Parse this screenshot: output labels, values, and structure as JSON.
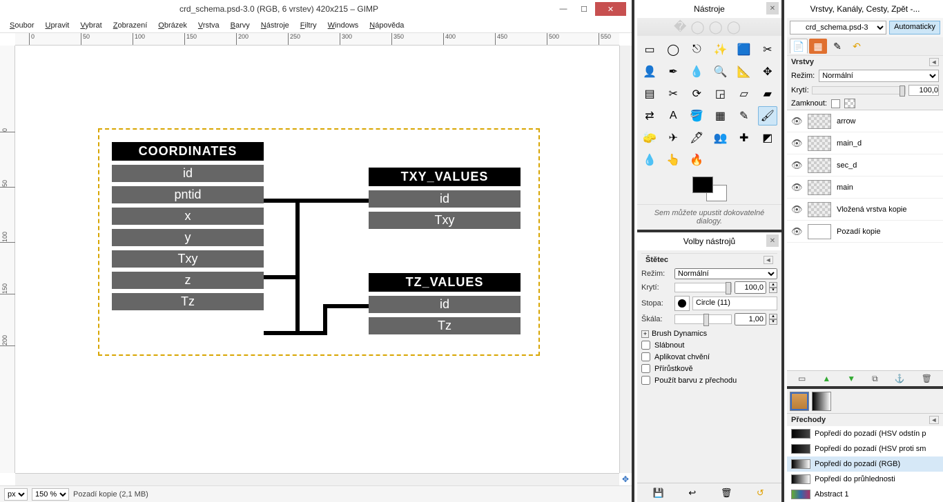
{
  "title": "crd_schema.psd-3.0 (RGB, 6 vrstev) 420x215 – GIMP",
  "menubar": [
    "Soubor",
    "Upravit",
    "Vybrat",
    "Zobrazení",
    "Obrázek",
    "Vrstva",
    "Barvy",
    "Nástroje",
    "Filtry",
    "Windows",
    "Nápověda"
  ],
  "ruler_h": [
    "0",
    "50",
    "100",
    "150",
    "200",
    "250",
    "300",
    "350",
    "400",
    "450",
    "500",
    "550"
  ],
  "ruler_v": [
    "0",
    "50",
    "100",
    "150",
    "200"
  ],
  "schema": {
    "coordinates": {
      "title": "COORDINATES",
      "rows": [
        "id",
        "pntid",
        "x",
        "y",
        "Txy",
        "z",
        "Tz"
      ]
    },
    "txy": {
      "title": "TXY_VALUES",
      "rows": [
        "id",
        "Txy"
      ]
    },
    "tz": {
      "title": "TZ_VALUES",
      "rows": [
        "id",
        "Tz"
      ]
    }
  },
  "statusbar": {
    "unit": "px",
    "zoom": "150 %",
    "info": "Pozadí kopie (2,1 MB)"
  },
  "toolbox": {
    "title": "Nástroje",
    "drop_hint": "Sem můžete upustit dokovatelné dialogy.",
    "options_title": "Volby nástrojů",
    "tool_name": "Štětec",
    "mode_label": "Režim:",
    "mode_value": "Normální",
    "opacity_label": "Krytí:",
    "opacity_value": "100,0",
    "brush_label": "Stopa:",
    "brush_name": "Circle (11)",
    "scale_label": "Škála:",
    "scale_value": "1,00",
    "dynamics": "Brush Dynamics",
    "chk_fade": "Slábnout",
    "chk_jitter": "Aplikovat chvění",
    "chk_incremental": "Přírůstkově",
    "chk_gradient": "Použít barvu z přechodu"
  },
  "layers_dock": {
    "title": "Vrstvy, Kanály, Cesty, Zpět -...",
    "image_name": "crd_schema.psd-3",
    "auto": "Automaticky",
    "panel": "Vrstvy",
    "mode_label": "Režim:",
    "mode_value": "Normální",
    "opacity_label": "Krytí:",
    "opacity_value": "100,0",
    "lock_label": "Zamknout:",
    "layers": [
      "arrow",
      "main_d",
      "sec_d",
      "main",
      "Vložená vrstva kopie",
      "Pozadí kopie"
    ],
    "gradients_title": "Přechody",
    "gradients": [
      "Popředí do pozadí (HSV odstín p",
      "Popředí do pozadí (HSV proti sm",
      "Popředí do pozadí (RGB)",
      "Popředí do průhlednosti",
      "Abstract 1"
    ],
    "grad_selected": 2
  }
}
